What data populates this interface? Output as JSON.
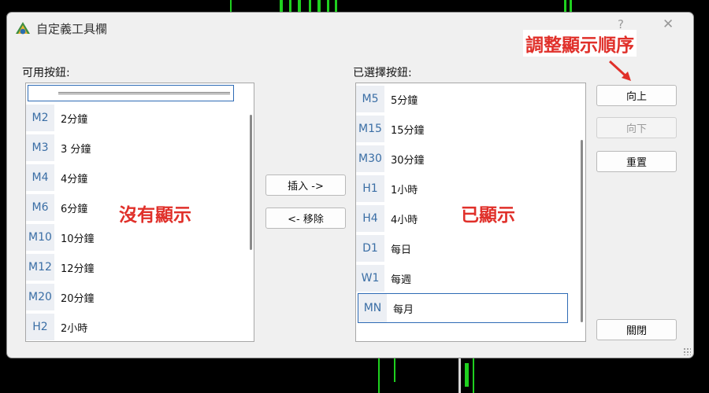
{
  "window": {
    "title": "自定義工具欄",
    "help_label": "?",
    "close_label": "✕"
  },
  "available": {
    "label": "可用按鈕:",
    "items": [
      {
        "code": "M2",
        "name": "2分鐘"
      },
      {
        "code": "M3",
        "name": "3 分鐘"
      },
      {
        "code": "M4",
        "name": "4分鐘"
      },
      {
        "code": "M6",
        "name": "6分鐘"
      },
      {
        "code": "M10",
        "name": "10分鐘"
      },
      {
        "code": "M12",
        "name": "12分鐘"
      },
      {
        "code": "M20",
        "name": "20分鐘"
      },
      {
        "code": "H2",
        "name": "2小時"
      }
    ]
  },
  "selected": {
    "label": "已選擇按鈕:",
    "items": [
      {
        "code": "M5",
        "name": "5分鐘"
      },
      {
        "code": "M15",
        "name": "15分鐘"
      },
      {
        "code": "M30",
        "name": "30分鐘"
      },
      {
        "code": "H1",
        "name": "1小時"
      },
      {
        "code": "H4",
        "name": "4小時"
      },
      {
        "code": "D1",
        "name": "每日"
      },
      {
        "code": "W1",
        "name": "每週"
      },
      {
        "code": "MN",
        "name": "每月"
      }
    ]
  },
  "buttons": {
    "insert": "插入 ->",
    "remove": "<- 移除",
    "move_up": "向上",
    "move_down": "向下",
    "reset": "重置",
    "close": "關閉"
  },
  "annotations": {
    "reorder": "調整顯示順序",
    "not_shown": "沒有顯示",
    "shown": "已顯示"
  },
  "colors": {
    "annotation": "#e0302a",
    "code_text": "#3a6ea5",
    "selection_border": "#2e6bb5"
  }
}
